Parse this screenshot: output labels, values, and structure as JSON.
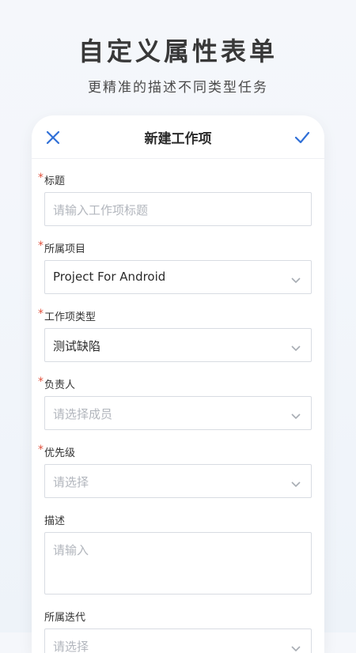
{
  "hero": {
    "title": "自定义属性表单",
    "subtitle": "更精准的描述不同类型任务"
  },
  "header": {
    "title": "新建工作项",
    "close_icon": "close-icon",
    "confirm_icon": "check-icon"
  },
  "form": {
    "required_mark": "*",
    "title_label": "标题",
    "title_placeholder": "请输入工作项标题",
    "project_label": "所属项目",
    "project_value": "Project For Android",
    "type_label": "工作项类型",
    "type_value": "测试缺陷",
    "assignee_label": "负责人",
    "assignee_placeholder": "请选择成员",
    "priority_label": "优先级",
    "priority_placeholder": "请选择",
    "desc_label": "描述",
    "desc_placeholder": "请输入",
    "iteration_label": "所属迭代",
    "iteration_placeholder": "请选择"
  },
  "colors": {
    "accent": "#2f6fd7",
    "required": "#e1533f",
    "border": "#d8dce2",
    "placeholder": "#b2b6bd"
  }
}
